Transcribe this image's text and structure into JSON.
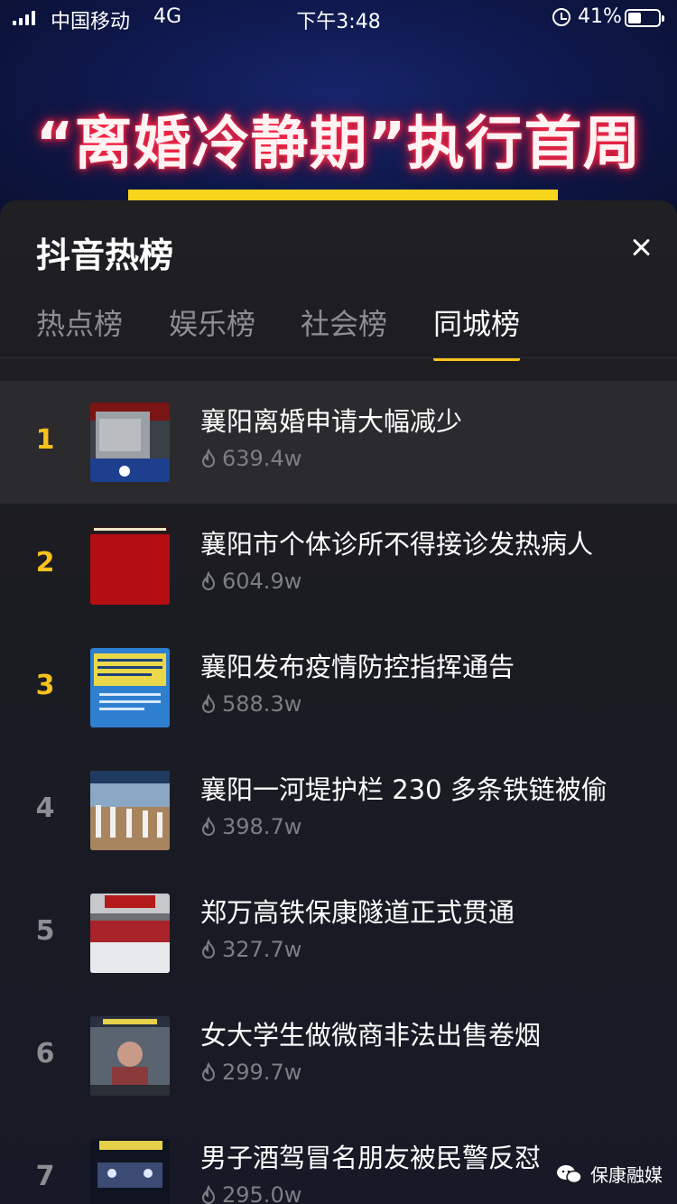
{
  "status_bar": {
    "carrier": "中国移动",
    "network": "4G",
    "time": "下午3:48",
    "battery_percent": "41%",
    "battery_level": 0.41
  },
  "banner": {
    "title": "“离婚冷静期”执行首周",
    "bar_color": "#f6d51b"
  },
  "panel": {
    "title": "抖音热榜",
    "close_icon": "close-icon",
    "tabs": [
      {
        "label": "热点榜",
        "active": false
      },
      {
        "label": "娱乐榜",
        "active": false
      },
      {
        "label": "社会榜",
        "active": false
      },
      {
        "label": "同城榜",
        "active": true
      }
    ],
    "accent_color": "#f6c21b"
  },
  "hot_list": [
    {
      "rank": "1",
      "title": "襄阳离婚申请大幅减少",
      "heat": "639.4w",
      "thumb": "office-scene"
    },
    {
      "rank": "2",
      "title": "襄阳市个体诊所不得接诊发热病人",
      "heat": "604.9w",
      "thumb": "red-notice"
    },
    {
      "rank": "3",
      "title": "襄阳发布疫情防控指挥通告",
      "heat": "588.3w",
      "thumb": "blue-announcement"
    },
    {
      "rank": "4",
      "title": "襄阳一河堤护栏 230 多条铁链被偷",
      "heat": "398.7w",
      "thumb": "riverbank-posts"
    },
    {
      "rank": "5",
      "title": "郑万高铁保康隧道正式贯通",
      "heat": "327.7w",
      "thumb": "tunnel-ceremony"
    },
    {
      "rank": "6",
      "title": "女大学生做微商非法出售卷烟",
      "heat": "299.7w",
      "thumb": "blurred-person"
    },
    {
      "rank": "7",
      "title": "男子酒驾冒名朋友被民警反怼",
      "heat": "295.0w",
      "thumb": "night-police"
    }
  ],
  "watermark": {
    "text": "保康融媒",
    "icon": "wechat-icon"
  }
}
